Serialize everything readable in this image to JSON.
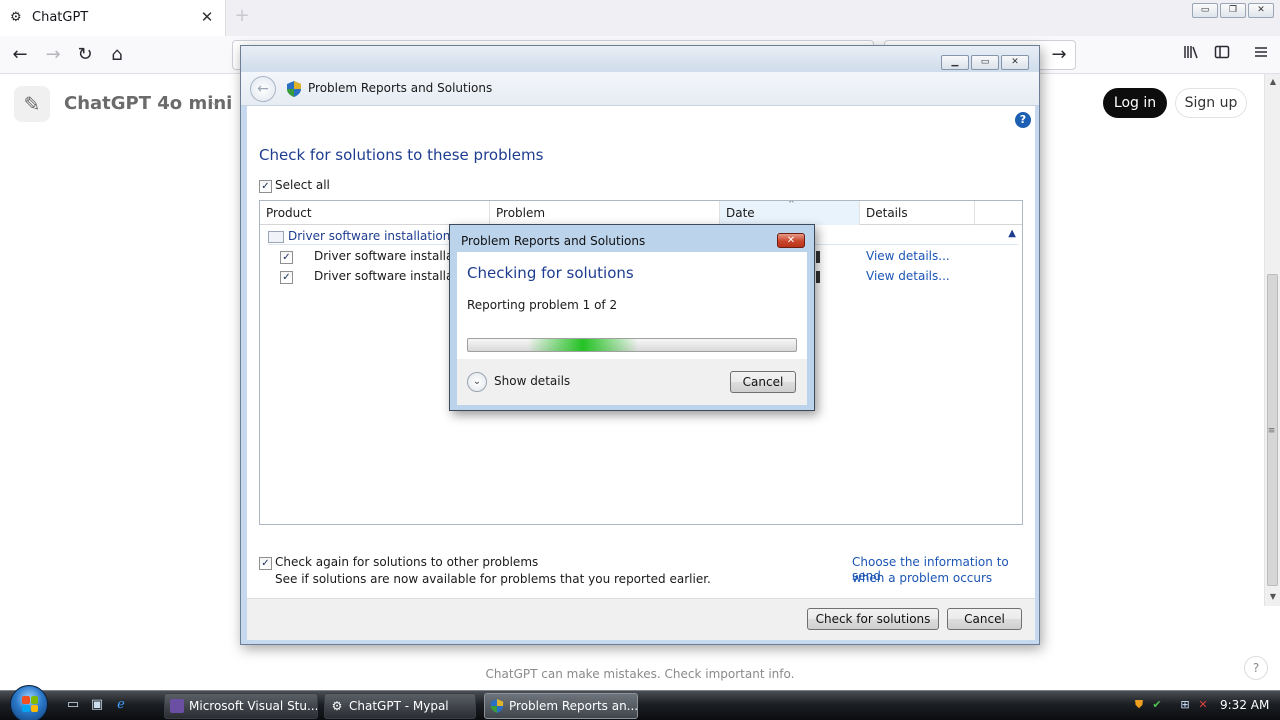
{
  "browser": {
    "tab_title": "ChatGPT",
    "tab_close": "✕",
    "new_tab": "+",
    "window_controls": [
      "▭",
      "❐",
      "✕"
    ],
    "nav": {
      "back": "←",
      "forward": "→",
      "reload": "↻",
      "home": "⌂",
      "search_go": "→"
    },
    "toolbar_icons": [
      "library-icon",
      "sidebar-icon",
      "menu-icon"
    ]
  },
  "page": {
    "model_name": "ChatGPT 4o mini",
    "model_chevron": "⌵",
    "login_label": "Log in",
    "signup_label": "Sign up",
    "footer_note": "ChatGPT can make mistakes. Check important info.",
    "help_label": "?"
  },
  "problem_window": {
    "title": "Problem Reports and Solutions",
    "heading": "Check for solutions to these problems",
    "select_all_label": "Select all",
    "columns": [
      "Product",
      "Problem",
      "Date",
      "Details"
    ],
    "group_label": "Driver software installation (2)",
    "rows": [
      {
        "product": "Driver software installation",
        "details_link": "View details..."
      },
      {
        "product": "Driver software installation",
        "details_link": "View details..."
      }
    ],
    "check_again_label": "Check again for solutions to other problems",
    "check_again_sub": "See if solutions are now available for problems that you reported earlier.",
    "choose_info_link_line1": "Choose the information to send",
    "choose_info_link_line2": "when a problem occurs",
    "check_button": "Check for solutions",
    "cancel_button": "Cancel",
    "help_label": "?"
  },
  "dialog": {
    "title": "Problem Reports and Solutions",
    "heading": "Checking for solutions",
    "status": "Reporting problem 1 of 2",
    "show_details_label": "Show details",
    "cancel_button": "Cancel",
    "close_label": "✕",
    "progress": "indeterminate"
  },
  "taskbar": {
    "tasks": [
      {
        "label": "Microsoft Visual Stu..."
      },
      {
        "label": "ChatGPT - Mypal"
      },
      {
        "label": "Problem Reports an..."
      }
    ],
    "clock": "9:32 AM"
  },
  "colors": {
    "link_blue": "#1c55b4",
    "heading_blue": "#1e3d8f",
    "progress_green": "#24c324",
    "close_red": "#c8452c"
  }
}
